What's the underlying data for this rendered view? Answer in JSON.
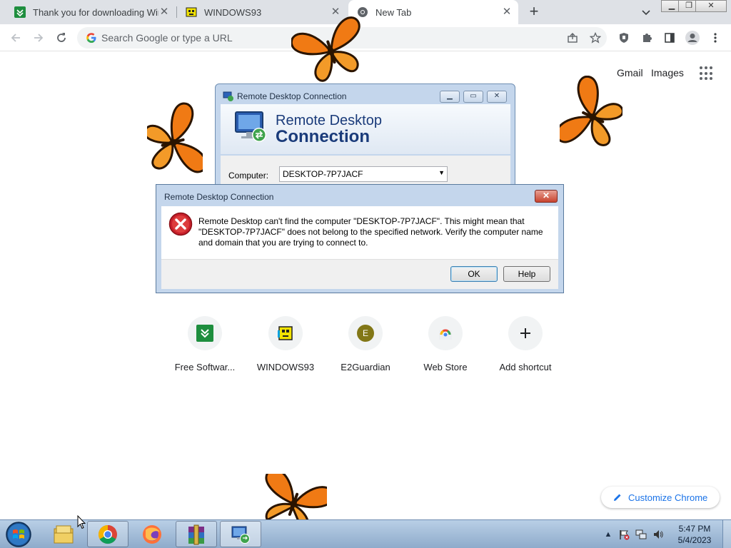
{
  "browser": {
    "tabs": [
      {
        "title": "Thank you for downloading WinRAR",
        "active": false
      },
      {
        "title": "WINDOWS93",
        "active": false
      },
      {
        "title": "New Tab",
        "active": true
      }
    ],
    "omnibox_placeholder": "Search Google or type a URL"
  },
  "ntp": {
    "links": {
      "gmail": "Gmail",
      "images": "Images"
    },
    "shortcuts": [
      {
        "label": "Free Softwar...",
        "icon": "free-software-icon"
      },
      {
        "label": "WINDOWS93",
        "icon": "windows93-icon"
      },
      {
        "label": "E2Guardian",
        "icon": "e2guardian-icon",
        "initial": "E"
      },
      {
        "label": "Web Store",
        "icon": "web-store-icon"
      },
      {
        "label": "Add shortcut",
        "icon": "plus-icon"
      }
    ],
    "customize_label": "Customize Chrome"
  },
  "rdc_window": {
    "title": "Remote Desktop Connection",
    "heading_line1": "Remote Desktop",
    "heading_line2": "Connection",
    "computer_label": "Computer:",
    "computer_value": "DESKTOP-7P7JACF"
  },
  "error_dialog": {
    "title": "Remote Desktop Connection",
    "message": "Remote Desktop can't find the computer \"DESKTOP-7P7JACF\". This might mean that \"DESKTOP-7P7JACF\" does not belong to the specified network.  Verify the computer name and domain that you are trying to connect to.",
    "ok_label": "OK",
    "help_label": "Help",
    "close_glyph": "✕"
  },
  "taskbar": {
    "items": [
      "file-explorer-icon",
      "chrome-icon",
      "firefox-icon",
      "winrar-icon",
      "remote-desktop-icon"
    ],
    "clock_time": "5:47 PM",
    "clock_date": "5/4/2023"
  },
  "colors": {
    "accent": "#1a73e8",
    "window_frame": "#c4d6ec",
    "taskbar": "#9fbad7",
    "butterfly_orange": "#f07a14"
  }
}
